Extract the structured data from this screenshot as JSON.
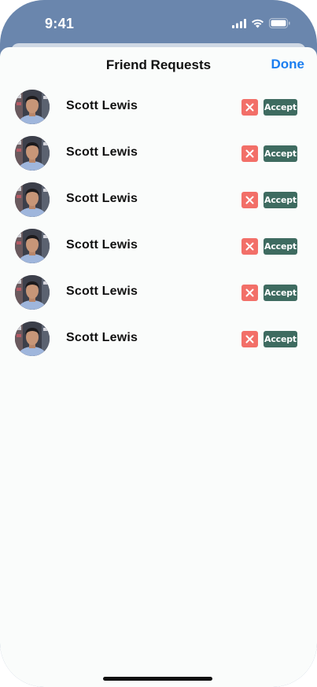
{
  "status_bar": {
    "time": "9:41",
    "icons": [
      "signal-icon",
      "wifi-icon",
      "battery-icon"
    ]
  },
  "header": {
    "title": "Friend Requests",
    "done_label": "Done"
  },
  "requests": [
    {
      "name": "Scott Lewis",
      "reject_icon": "close-icon",
      "accept_label": "Accept"
    },
    {
      "name": "Scott Lewis",
      "reject_icon": "close-icon",
      "accept_label": "Accept"
    },
    {
      "name": "Scott Lewis",
      "reject_icon": "close-icon",
      "accept_label": "Accept"
    },
    {
      "name": "Scott Lewis",
      "reject_icon": "close-icon",
      "accept_label": "Accept"
    },
    {
      "name": "Scott Lewis",
      "reject_icon": "close-icon",
      "accept_label": "Accept"
    },
    {
      "name": "Scott Lewis",
      "reject_icon": "close-icon",
      "accept_label": "Accept"
    }
  ],
  "colors": {
    "status_bar_bg": "#6a86ad",
    "sheet_bg": "#fafcfb",
    "done": "#1b7ef0",
    "reject": "#f26f68",
    "accept": "#3e6b60"
  }
}
